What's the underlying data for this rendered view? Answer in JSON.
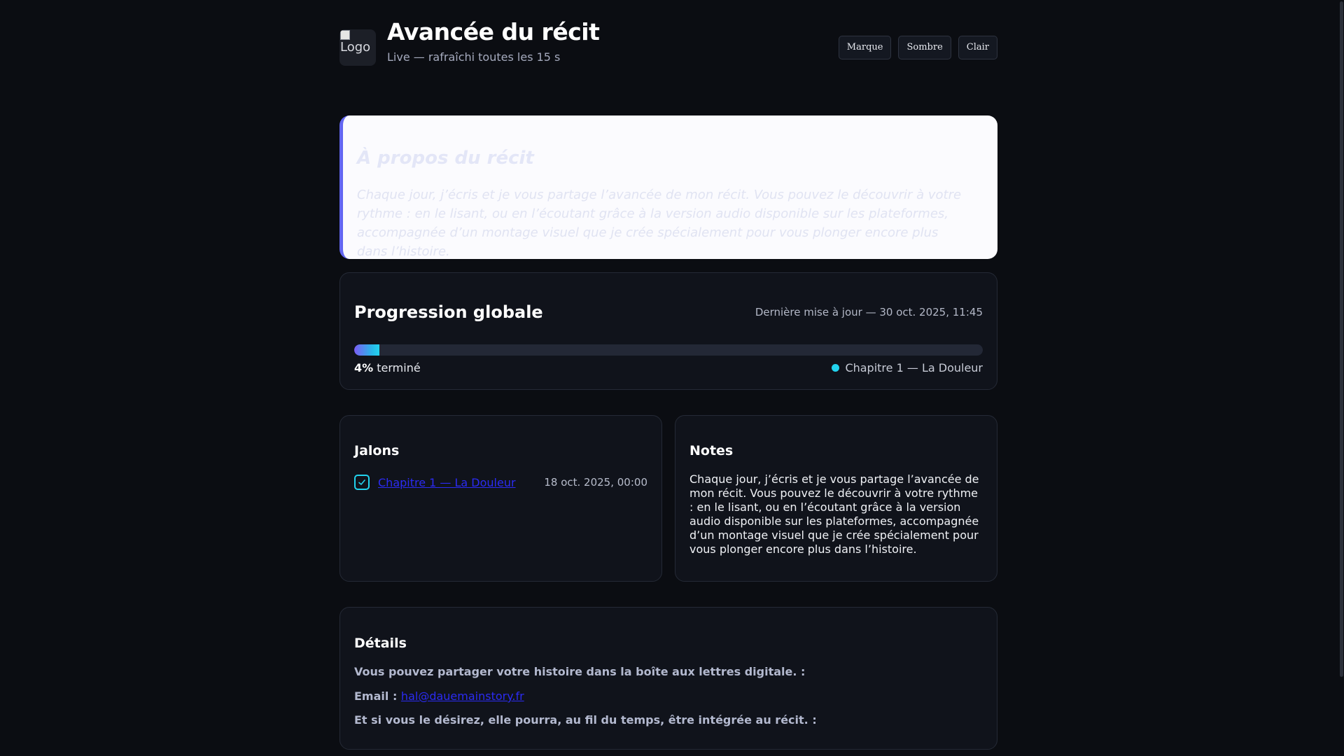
{
  "header": {
    "logo_alt": "Logo",
    "title": "Avancée du récit",
    "subtitle": "Live — rafraîchi toutes les 15 s",
    "theme_buttons": [
      "Marque",
      "Sombre",
      "Clair"
    ]
  },
  "about": {
    "title": "À propos du récit",
    "text": "Chaque jour, j’écris et je vous partage l’avancée de mon récit. Vous pouvez le découvrir à votre rythme : en le lisant, ou en l’écoutant grâce à la version audio disponible sur les plateformes, accompagnée d’un montage visuel que je crée spécialement pour vous plonger encore plus dans l’histoire."
  },
  "progress": {
    "title": "Progression globale",
    "last_update": "Dernière mise à jour — 30 oct. 2025, 11:45",
    "percent_label": "4%",
    "percent_value": 4,
    "done_label": "terminé",
    "current_chapter": "Chapitre 1 — La Douleur"
  },
  "milestones": {
    "title": "Jalons",
    "items": [
      {
        "label": "Chapitre 1 — La Douleur",
        "date": "18 oct. 2025, 00:00",
        "done": true
      }
    ]
  },
  "notes": {
    "title": "Notes",
    "text": "Chaque jour, j’écris et je vous partage l’avancée de mon récit. Vous pouvez le découvrir à votre rythme : en le lisant, ou en l’écoutant grâce à la version audio disponible sur les plateformes, accompagnée d’un montage visuel que je crée spécialement pour vous plonger encore plus dans l’histoire."
  },
  "details": {
    "title": "Détails",
    "line1": "Vous pouvez partager votre histoire dans la boîte aux lettres digitale. :",
    "email_label": "Email :",
    "email": "hal@dauemainstory.fr",
    "line3": "Et si vous le désirez, elle pourra, au fil du temps, être intégrée au récit. :"
  },
  "colors": {
    "background": "#0b0d12",
    "card": "#10131b",
    "accent": "#6366f1",
    "progress_cyan": "#22d3ee",
    "link": "#2b2bf2"
  }
}
